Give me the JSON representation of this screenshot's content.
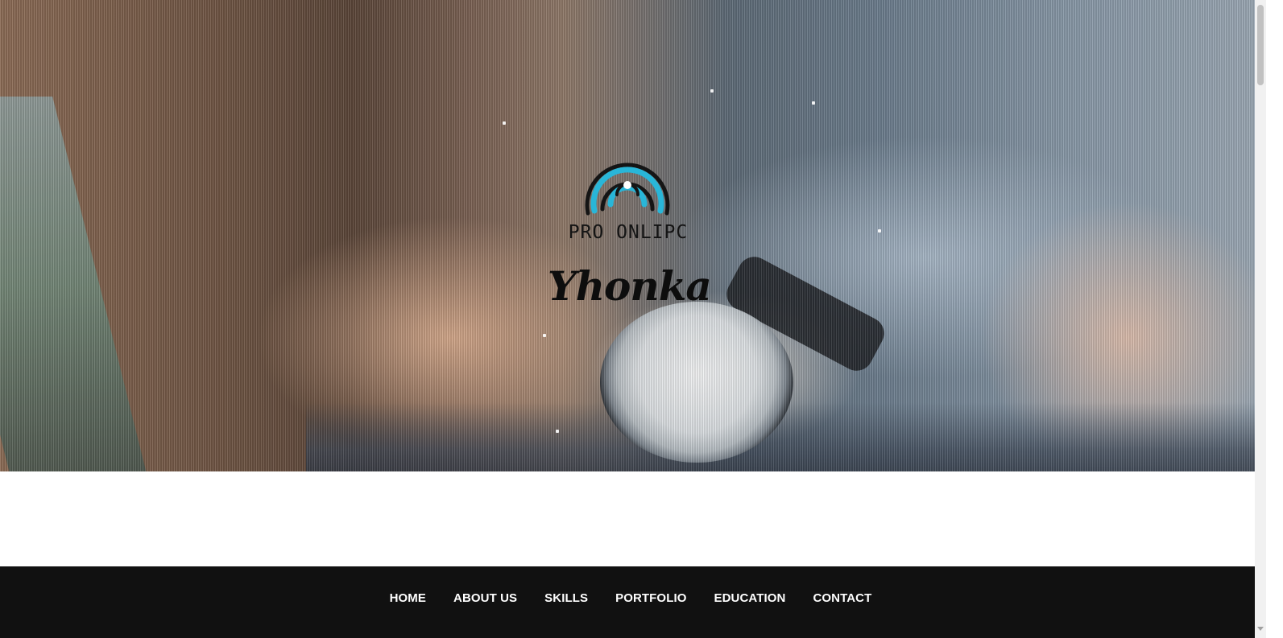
{
  "hero": {
    "brand_name": "PRO ONLIPC",
    "signature": "Yhonka",
    "logo_colors": {
      "outer_ring": "#151515",
      "inner_ring": "#29b6d8",
      "center": "#ffffff"
    }
  },
  "nav": {
    "items": [
      {
        "label": "HOME"
      },
      {
        "label": "ABOUT US"
      },
      {
        "label": "SKILLS"
      },
      {
        "label": "PORTFOLIO"
      },
      {
        "label": "EDUCATION"
      },
      {
        "label": "CONTACT"
      }
    ],
    "background_color": "#111111",
    "text_color": "#ffffff"
  }
}
